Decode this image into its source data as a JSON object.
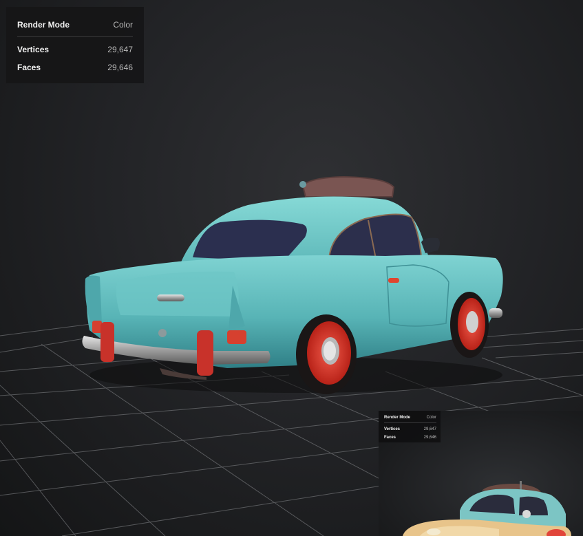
{
  "info_panel": {
    "render_mode_label": "Render Mode",
    "render_mode_value": "Color",
    "vertices_label": "Vertices",
    "vertices_value": "29,647",
    "faces_label": "Faces",
    "faces_value": "29,646"
  },
  "thumbnail": {
    "render_mode_label": "Render Mode",
    "render_mode_value": "Color",
    "vertices_label": "Vertices",
    "vertices_value": "29,647",
    "faces_label": "Faces",
    "faces_value": "29,646"
  },
  "colors": {
    "car_body": "#5bb7b8",
    "wheel": "#d8342a",
    "thumb_car_body": "#e9c98a"
  }
}
